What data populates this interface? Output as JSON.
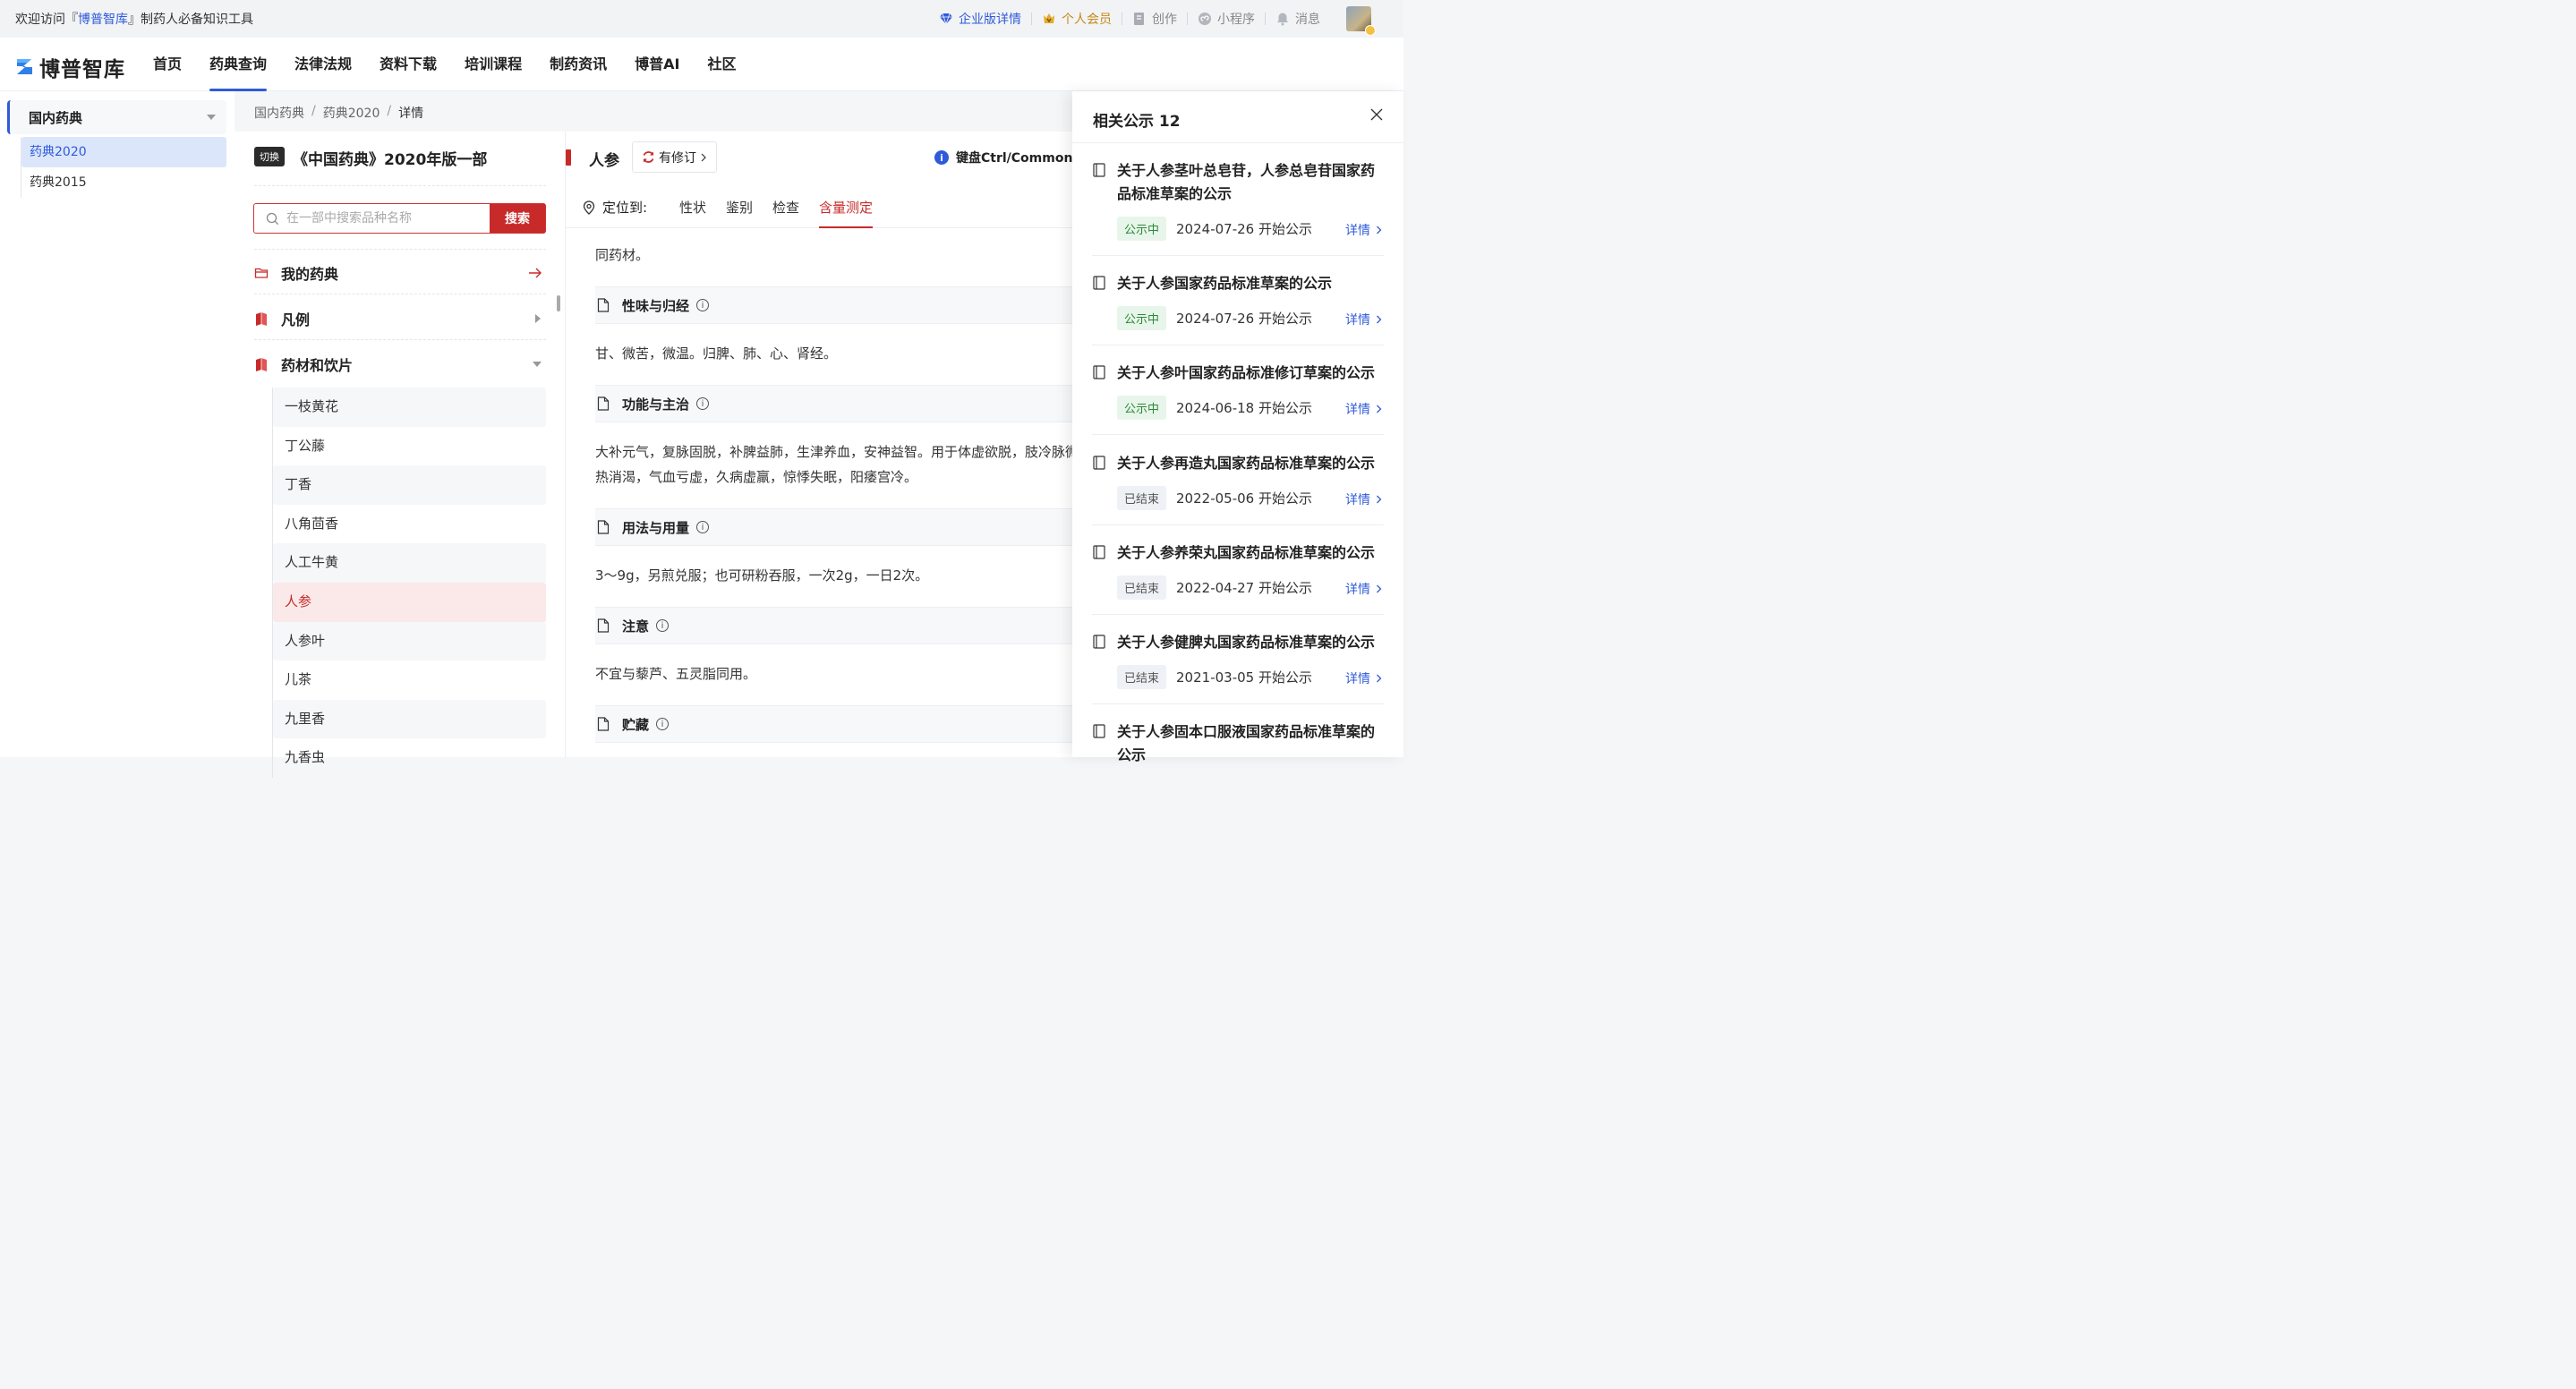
{
  "topbar": {
    "welcome_prefix": "欢迎访问『",
    "welcome_brand": "博普智库",
    "welcome_suffix": "』制药人必备知识工具",
    "enterprise": "企业版详情",
    "vip": "个人会员",
    "create": "创作",
    "miniapp": "小程序",
    "messages": "消息"
  },
  "nav": {
    "logo": "博普智库",
    "items": [
      "首页",
      "药典查询",
      "法律法规",
      "资料下载",
      "培训课程",
      "制药资讯",
      "博普AI",
      "社区"
    ],
    "active_index": 1
  },
  "sidebar": {
    "title": "国内药典",
    "items": [
      "药典2020",
      "药典2015"
    ],
    "active_index": 0
  },
  "breadcrumb": [
    "国内药典",
    "药典2020",
    "详情"
  ],
  "edition": {
    "switch_label": "切换",
    "title": "《中国药典》2020年版一部"
  },
  "search": {
    "placeholder": "在一部中搜索品种名称",
    "button": "搜索"
  },
  "groups": {
    "mine": "我的药典",
    "fanli": "凡例",
    "materials": "药材和饮片"
  },
  "medicines": [
    "一枝黄花",
    "丁公藤",
    "丁香",
    "八角茴香",
    "人工牛黄",
    "人参",
    "人参叶",
    "儿茶",
    "九里香",
    "九香虫"
  ],
  "active_medicine_index": 5,
  "herb": {
    "name": "人参",
    "revision": "有修订",
    "kbd_tip": "键盘Ctrl/Commond"
  },
  "locator": {
    "label": "定位到:",
    "tabs": [
      "性状",
      "鉴别",
      "检查",
      "含量测定"
    ],
    "active_index": 3
  },
  "content": {
    "intro": "同药材。",
    "sections": [
      {
        "title": "性味与归经",
        "lines": [
          "甘、微苦，微温。归脾、肺、心、肾经。"
        ]
      },
      {
        "title": "功能与主治",
        "lines": [
          "大补元气，复脉固脱，补脾益肺，生津养血，安神益智。用于体虚欲脱，肢冷脉微，脾虚食少，肺虚喘咳，津伤口渴，内",
          "热消渴，气血亏虚，久病虚羸，惊悸失眠，阳痿宫冷。"
        ]
      },
      {
        "title": "用法与用量",
        "lines": [
          "3～9g，另煎兑服；也可研粉吞服，一次2g，一日2次。"
        ]
      },
      {
        "title": "注意",
        "lines": [
          "不宜与藜芦、五灵脂同用。"
        ]
      },
      {
        "title": "贮藏",
        "lines": []
      }
    ]
  },
  "drawer": {
    "title": "相关公示 12",
    "detail_label": "详情",
    "notices": [
      {
        "title": "关于人参茎叶总皂苷，人参总皂苷国家药品标准草案的公示",
        "status": "公示中",
        "date": "2024-07-26 开始公示",
        "active": true
      },
      {
        "title": "关于人参国家药品标准草案的公示",
        "status": "公示中",
        "date": "2024-07-26 开始公示",
        "active": true
      },
      {
        "title": "关于人参叶国家药品标准修订草案的公示",
        "status": "公示中",
        "date": "2024-06-18 开始公示",
        "active": true
      },
      {
        "title": "关于人参再造丸国家药品标准草案的公示",
        "status": "已结束",
        "date": "2022-05-06 开始公示",
        "active": false
      },
      {
        "title": "关于人参养荣丸国家药品标准草案的公示",
        "status": "已结束",
        "date": "2022-04-27 开始公示",
        "active": false
      },
      {
        "title": "关于人参健脾丸国家药品标准草案的公示",
        "status": "已结束",
        "date": "2021-03-05 开始公示",
        "active": false
      },
      {
        "title": "关于人参固本口服液国家药品标准草案的公示",
        "status": "",
        "date": "",
        "active": false
      }
    ]
  },
  "colors": {
    "brand_blue": "#2f5bd9",
    "brand_red": "#c82a2a",
    "vip_gold": "#c68a1a",
    "status_green": "#2a8a3a"
  }
}
